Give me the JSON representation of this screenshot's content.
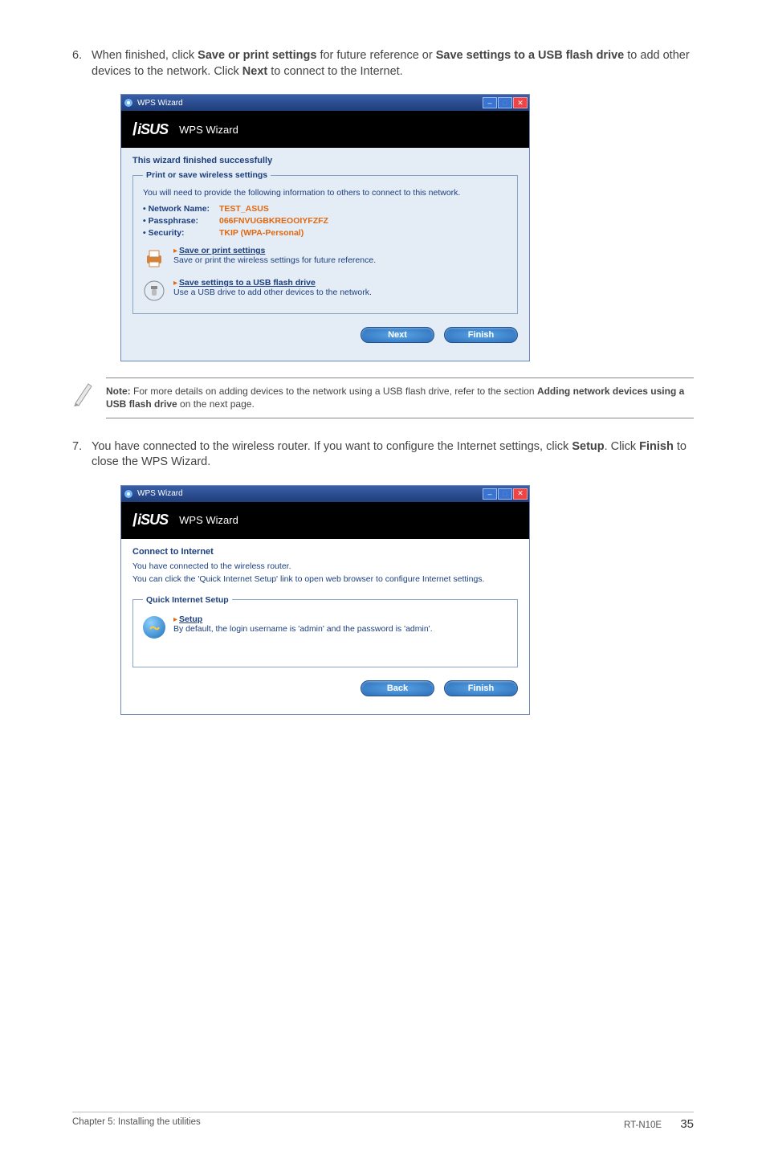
{
  "step6": {
    "num": "6.",
    "text_before": "When finished, click ",
    "bold1": "Save or print settings",
    "text_mid1": " for future reference or ",
    "bold2": "Save settings to a USB flash drive",
    "text_mid2": " to add other devices to the network. Click ",
    "bold3": "Next",
    "text_after": " to connect to the Internet."
  },
  "win1": {
    "title": "WPS Wizard",
    "bar_label": "WPS Wizard",
    "heading": "This wizard finished successfully",
    "group_legend": "Print or save wireless settings",
    "group_desc": "You will need to provide the following information to others to connect to this network.",
    "network_k": "• Network Name:",
    "network_v": "TEST_ASUS",
    "pass_k": "• Passphrase:",
    "pass_v": "066FNVUGBKREOOIYFZFZ",
    "sec_k": "• Security:",
    "sec_v": "TKIP (WPA-Personal)",
    "save_print_link": "Save or print settings",
    "save_print_desc": "Save or print the wireless settings for future reference.",
    "usb_link": "Save settings to a USB flash drive",
    "usb_desc": "Use a USB drive to add other devices to the network.",
    "btn_next": "Next",
    "btn_finish": "Finish"
  },
  "note": {
    "bold1": "Note:",
    "text1": " For more details on adding devices to the network using a USB flash drive, refer to the section ",
    "bold2": "Adding network devices using a USB flash drive",
    "text2": " on the next page."
  },
  "step7": {
    "num": "7.",
    "text_before": "You have connected to the wireless router. If you want to configure the Internet settings, click ",
    "bold1": "Setup",
    "text_mid1": ". Click ",
    "bold2": "Finish",
    "text_after": " to close the WPS Wizard."
  },
  "win2": {
    "title": "WPS Wizard",
    "bar_label": "WPS Wizard",
    "heading": "Connect to Internet",
    "line1": "You have connected to the wireless router.",
    "line2": "You can click the 'Quick Internet Setup' link to open web browser to configure Internet settings.",
    "group_legend": "Quick Internet Setup",
    "setup_link": "Setup",
    "setup_desc": "By default, the login username is 'admin' and the password is 'admin'.",
    "btn_back": "Back",
    "btn_finish": "Finish"
  },
  "footer": {
    "left": "Chapter 5: Installing the utilities",
    "model": "RT-N10E",
    "page": "35"
  }
}
